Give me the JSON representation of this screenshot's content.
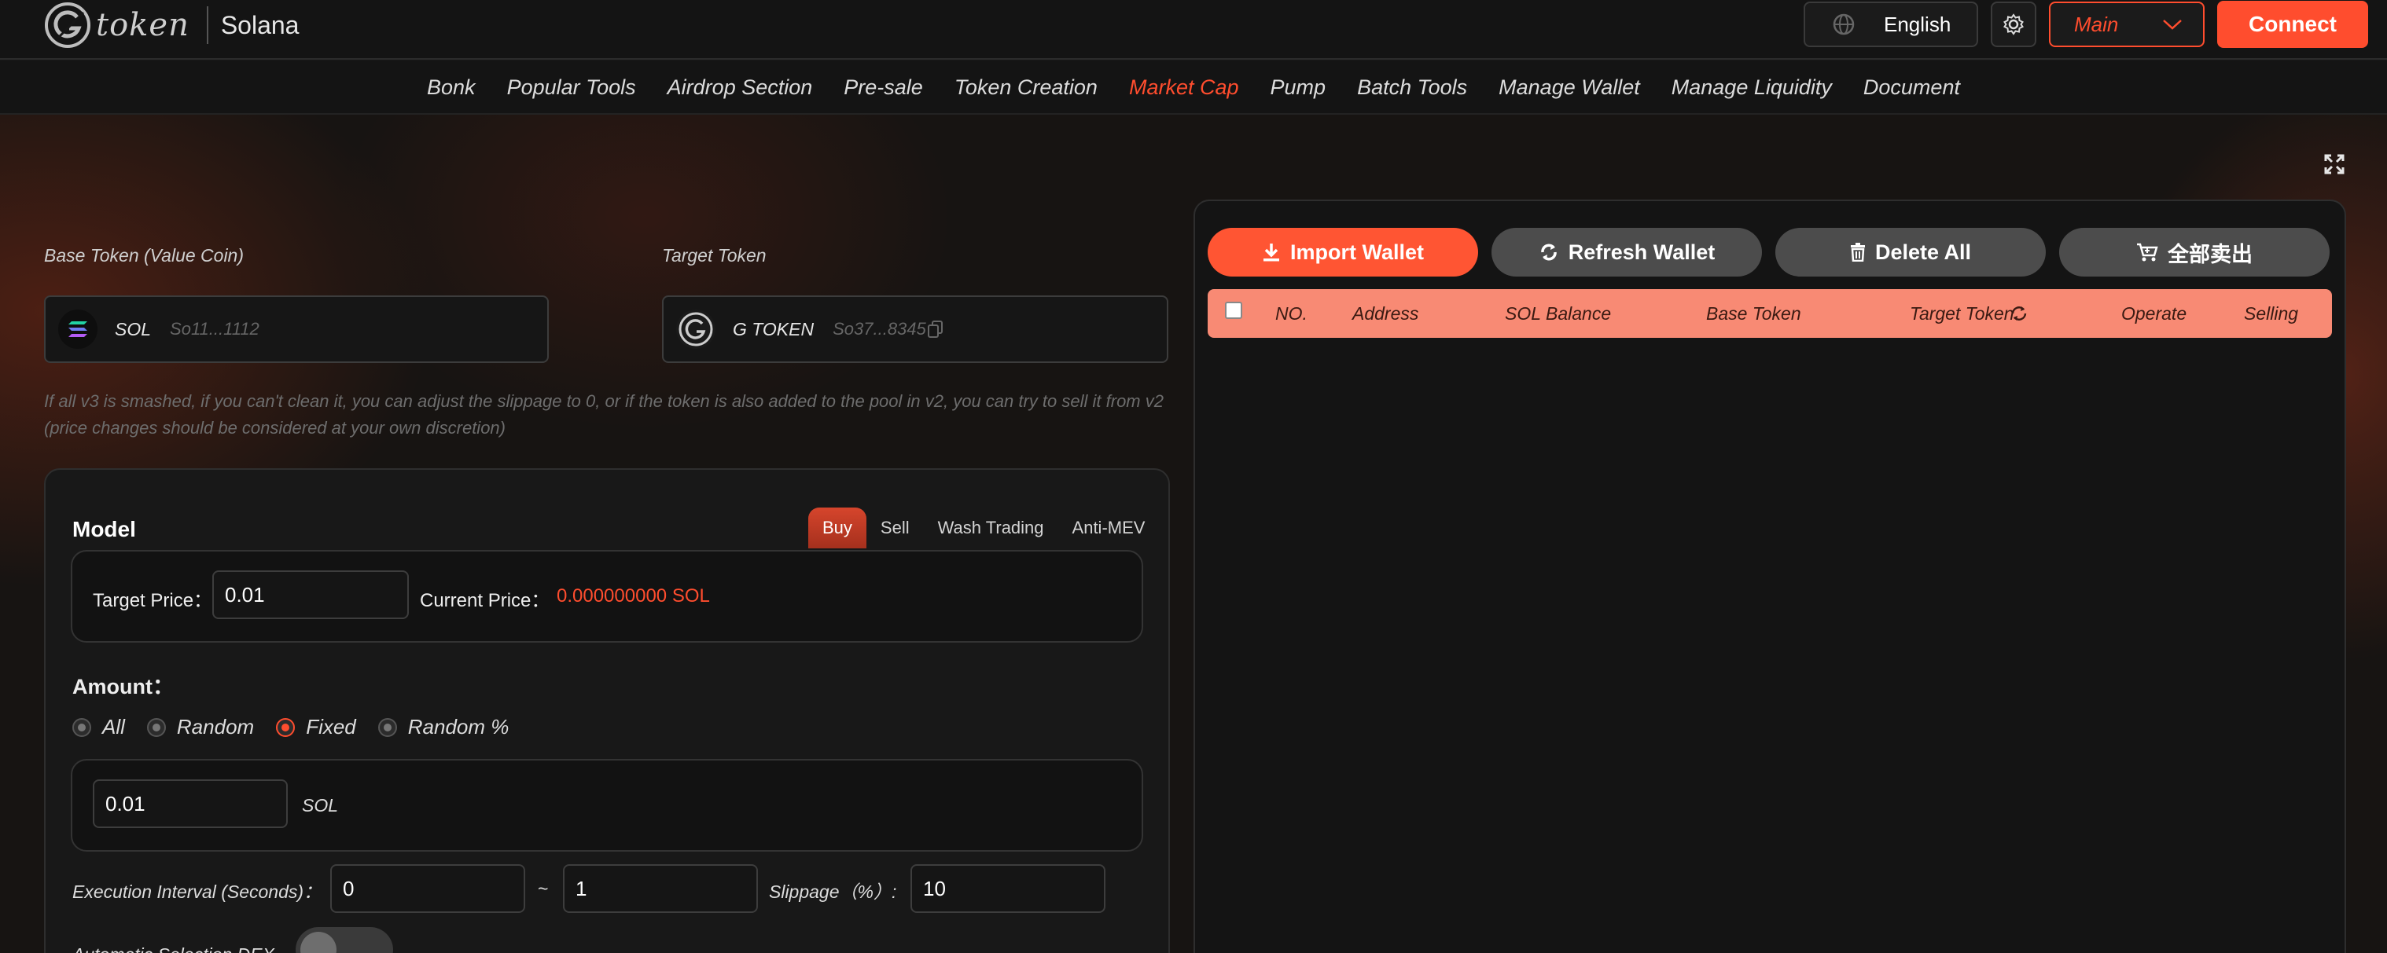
{
  "header": {
    "logo_text": "token",
    "chain": "Solana",
    "language": "English",
    "network": "Main",
    "connect_label": "Connect"
  },
  "nav": {
    "items": [
      "Bonk",
      "Popular Tools",
      "Airdrop Section",
      "Pre-sale",
      "Token Creation",
      "Market Cap",
      "Pump",
      "Batch Tools",
      "Manage Wallet",
      "Manage Liquidity",
      "Document"
    ],
    "active": "Market Cap"
  },
  "base_token": {
    "label": "Base Token (Value Coin)",
    "symbol": "SOL",
    "address": "So11...1112"
  },
  "target_token": {
    "label": "Target Token",
    "symbol": "G TOKEN",
    "address": "So37...8345"
  },
  "hint": "If all v3 is smashed, if you can't clean it, you can adjust the slippage to 0, or if the token is also added to the pool in v2, you can try to sell it from v2 (price changes should be considered at your own discretion)",
  "model": {
    "title": "Model",
    "tabs": [
      "Buy",
      "Sell",
      "Wash Trading",
      "Anti-MEV"
    ],
    "active_tab": "Buy",
    "target_price_label": "Target Price：",
    "target_price_value": "0.01",
    "current_price_label": "Current Price：",
    "current_price_value": "0.000000000 SOL"
  },
  "amount": {
    "title": "Amount：",
    "options": [
      "All",
      "Random",
      "Fixed",
      "Random %"
    ],
    "selected": "Fixed",
    "value": "0.01",
    "unit": "SOL"
  },
  "interval": {
    "label": "Execution Interval (Seconds)：",
    "min": "0",
    "separator": "~",
    "max": "1",
    "slippage_label": "Slippage（%）:",
    "slippage_value": "10"
  },
  "auto_dex": {
    "label": "Automatic Selection DEX"
  },
  "wallet_actions": {
    "import": "Import Wallet",
    "refresh": "Refresh Wallet",
    "delete": "Delete All",
    "sell_all": "全部卖出"
  },
  "table": {
    "columns": [
      "NO.",
      "Address",
      "SOL Balance",
      "Base Token",
      "Target Token",
      "Operate",
      "Selling"
    ]
  },
  "colors": {
    "accent": "#ff4d2e",
    "background": "#161616",
    "table_header": "#f88a74"
  }
}
